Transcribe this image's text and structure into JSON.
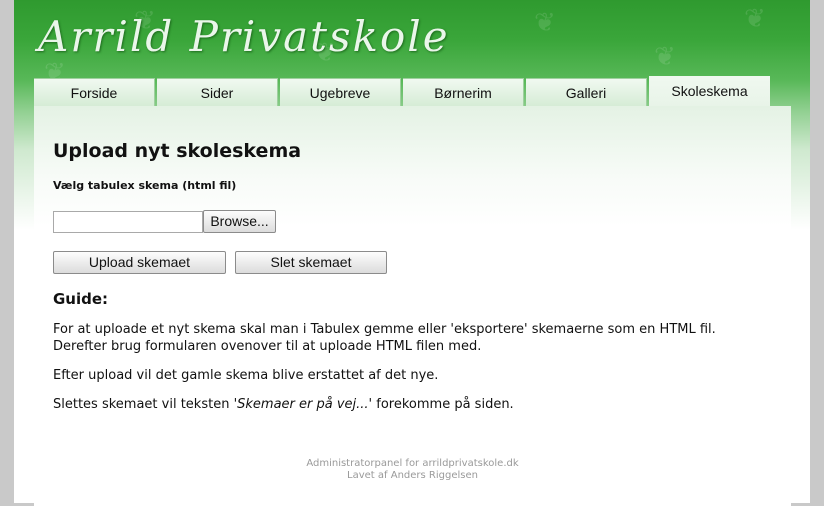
{
  "site": {
    "logo_text": "Arrild Privatskole"
  },
  "nav": {
    "tabs": [
      {
        "label": "Forside",
        "active": false
      },
      {
        "label": "Sider",
        "active": false
      },
      {
        "label": "Ugebreve",
        "active": false
      },
      {
        "label": "Børnerim",
        "active": false
      },
      {
        "label": "Galleri",
        "active": false
      },
      {
        "label": "Skoleskema",
        "active": true
      }
    ]
  },
  "main": {
    "title": "Upload nyt skoleskema",
    "file_label": "Vælg tabulex skema (html fil)",
    "file_value": "",
    "browse_label": "Browse...",
    "upload_label": "Upload skemaet",
    "delete_label": "Slet skemaet",
    "guide_heading": "Guide:",
    "guide_p1_line1": "For at uploade et nyt skema skal man i Tabulex gemme eller 'eksportere' skemaerne som en HTML fil.",
    "guide_p1_line2": "Derefter brug formularen ovenover til at uploade HTML filen med.",
    "guide_p2": "Efter upload vil det gamle skema blive erstattet af det nye.",
    "guide_p3_before": "Slettes skemaet vil teksten ",
    "guide_p3_italic": "'Skemaer er på vej...'",
    "guide_p3_after": " forekomme på siden."
  },
  "footer": {
    "line1": "Administratorpanel for arrildprivatskole.dk",
    "line2": "Lavet af Anders Riggelsen"
  },
  "colors": {
    "brand_green": "#3aa63a",
    "tab_border": "#9fd09f",
    "page_bg": "#c9c9c9"
  }
}
